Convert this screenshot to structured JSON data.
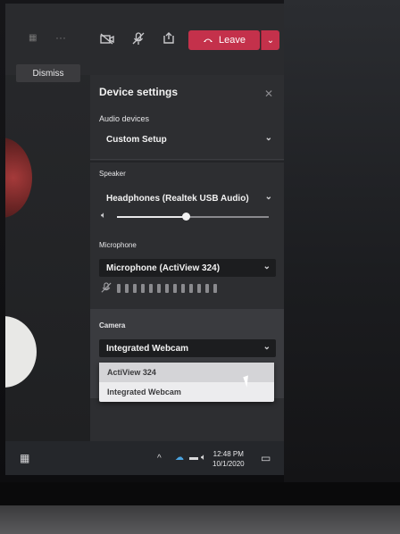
{
  "toolbar": {
    "leave_label": "Leave",
    "dismiss_label": "Dismiss"
  },
  "panel": {
    "title": "Device settings",
    "audio_label": "Audio devices",
    "audio_value": "Custom Setup",
    "speaker_label": "Speaker",
    "speaker_value": "Headphones (Realtek USB Audio)",
    "speaker_volume": 0.45,
    "mic_label": "Microphone",
    "mic_value": "Microphone (ActiView 324)",
    "camera_label": "Camera",
    "camera_value": "Integrated Webcam",
    "camera_options": [
      "ActiView 324",
      "Integrated Webcam"
    ]
  },
  "taskbar": {
    "time": "12:48 PM",
    "date": "10/1/2020"
  },
  "colors": {
    "leave_red": "#c4314b",
    "panel_bg": "#2d2e31"
  }
}
